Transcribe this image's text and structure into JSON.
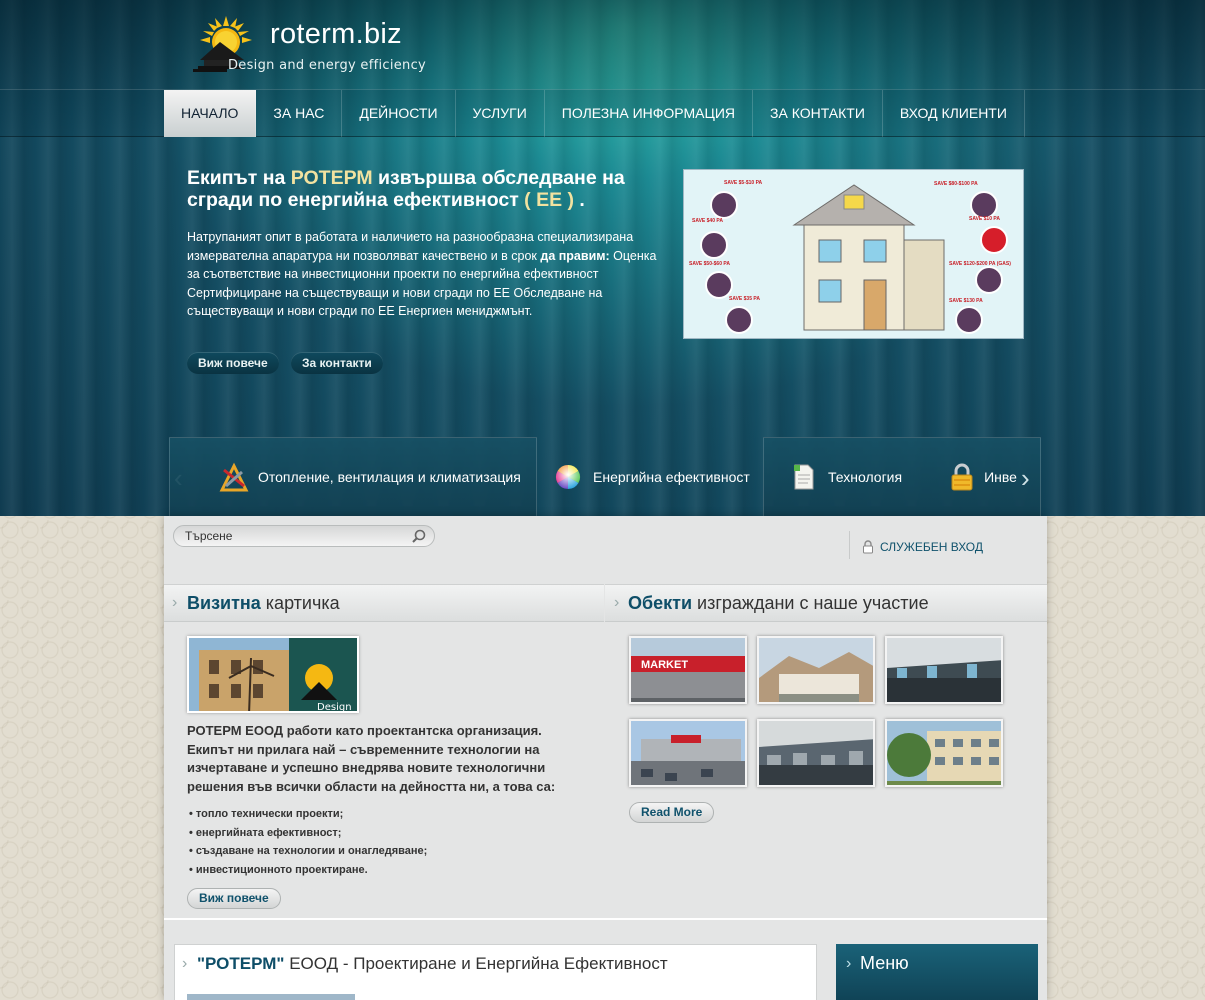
{
  "site": {
    "name": "roterm.biz",
    "tagline": "Design and energy efficiency"
  },
  "nav": {
    "items": [
      {
        "label": "НАЧАЛО",
        "active": true
      },
      {
        "label": "ЗА НАС"
      },
      {
        "label": "ДЕЙНОСТИ"
      },
      {
        "label": "УСЛУГИ"
      },
      {
        "label": "ПОЛЕЗНА ИНФОРМАЦИЯ"
      },
      {
        "label": "ЗА КОНТАКТИ"
      },
      {
        "label": "ВХОД КЛИЕНТИ"
      }
    ]
  },
  "hero": {
    "title_part1": "Екипът на ",
    "title_highlight": "РОТЕРМ",
    "title_part2": " извършва обследване на сгради по енергийна ефективност ",
    "title_highlight2": "( ЕЕ )",
    "title_end": " .",
    "text_part1": "Натрупаният опит в работата и наличието на разнообразна специализирана измервателна апаратура ни позволяват качествено и в срок ",
    "text_bold": "да правим:",
    "text_part2": " Оценка за съответствие на инвестиционни проекти по енергийна ефективност Сертифициране на съществуващи и нови сгради по ЕЕ Обследване на съществуващи и нови сгради по ЕЕ Енергиен мениджмънт.",
    "btn_more": "Виж повече",
    "btn_contacts": "За контакти"
  },
  "slider": {
    "tabs": [
      {
        "label": "Отопление, вентилация и климатизация",
        "icon": "tools-icon"
      },
      {
        "label": "Енергийна ефективност",
        "icon": "color-wheel-icon"
      },
      {
        "label": "Технология",
        "icon": "document-icon"
      },
      {
        "label": "Инве",
        "icon": "lock-icon"
      }
    ]
  },
  "search": {
    "placeholder": "Търсене"
  },
  "login": {
    "label": "СЛУЖЕБЕН ВХОД"
  },
  "vcard": {
    "title_strong": "Визитна",
    "title_rest": " картичка",
    "text": "РОТЕРМ ЕООД работи като проектантска организация. Екипът ни прилага най – съвременните технологии на изчертаване и успешно внедрява новите технологични решения във всички области на дейността ни, а това са:",
    "items": [
      "топло технически проекти;",
      "енергийната ефективност;",
      "създаване на технологии и онагледяване;",
      "инвестиционното проектиране."
    ],
    "btn": "Виж повече"
  },
  "projects": {
    "title_strong": "Обекти",
    "title_rest": " изграждани с наше участие",
    "thumb_market": "MARKET",
    "btn": "Read More"
  },
  "lower": {
    "title_strong": "\"РОТЕРМ\"",
    "title_rest": " ЕООД - Проектиране и Енергийна Ефективност"
  },
  "menu": {
    "title": "Меню"
  },
  "colors": {
    "accent": "#0e4e68",
    "hero_highlight": "#f2e2a0",
    "hero_bg": "#144e63"
  }
}
